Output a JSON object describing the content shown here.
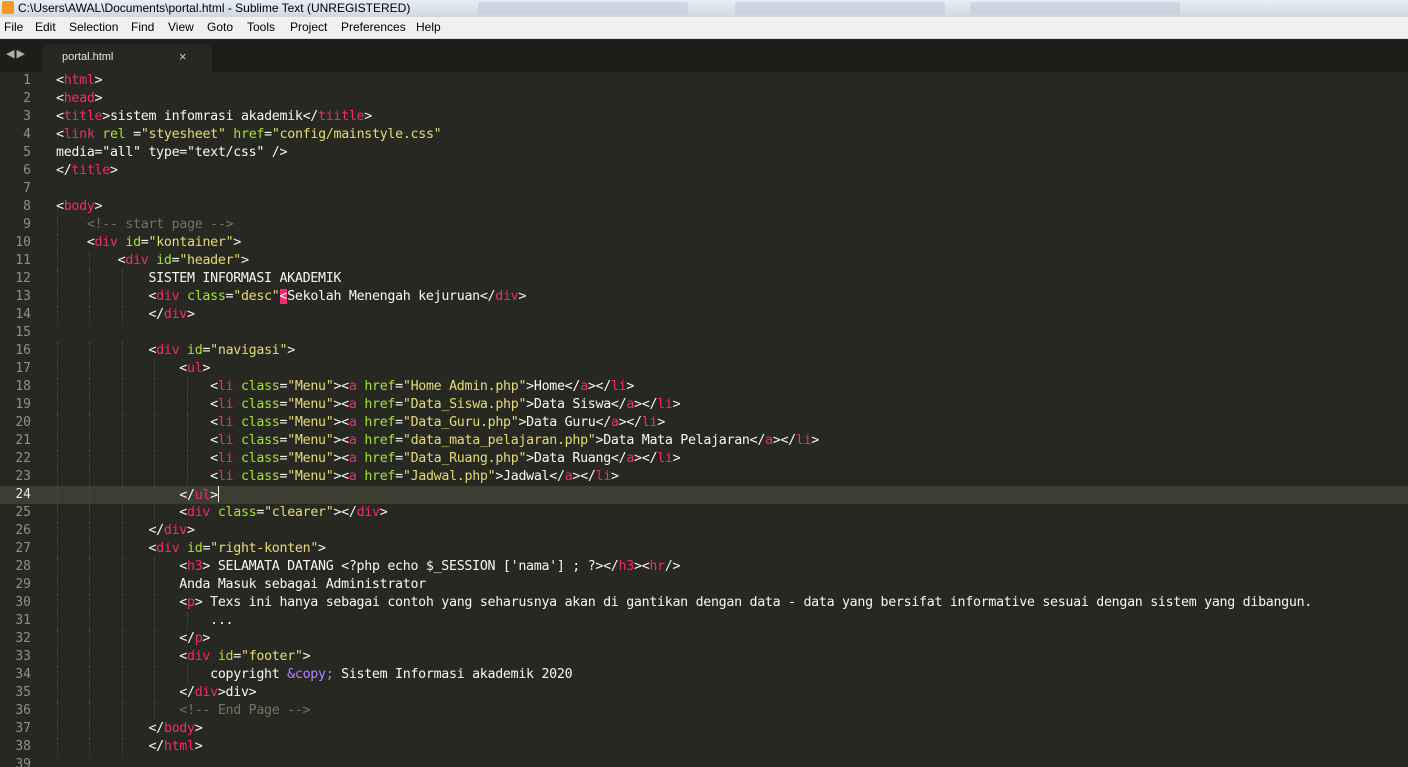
{
  "window": {
    "title": "C:\\Users\\AWAL\\Documents\\portal.html - Sublime Text (UNREGISTERED)"
  },
  "menu": [
    "File",
    "Edit",
    "Selection",
    "Find",
    "View",
    "Goto",
    "Tools",
    "Project",
    "Preferences",
    "Help"
  ],
  "tab": {
    "label": "portal.html",
    "close": "×"
  },
  "nav": {
    "back": "◀",
    "forward": "▶"
  },
  "editor": {
    "current_line": 24,
    "colors": {
      "background": "#272822",
      "tag": "#f92672",
      "attribute": "#a6e22e",
      "string": "#e6db74",
      "comment": "#75715e",
      "entity": "#ae81ff",
      "text": "#f8f8f2"
    },
    "lines": [
      "<html>",
      "<head>",
      "<title>sistem infomrasi akademik</tiitle>",
      "<link rel =\"styesheet\" href=\"config/mainstyle.css\"",
      "media=\"all\" type=\"text/css\" />",
      "</title>",
      "",
      "<body>",
      "    <!-- start page -->",
      "    <div id=\"kontainer\">",
      "        <div id=\"header\">",
      "            SISTEM INFORMASI AKADEMIK",
      "            <div class=\"desc\"<Sekolah Menengah kejuruan</div>",
      "            </div>",
      "",
      "            <div id=\"navigasi\">",
      "                <ul>",
      "                    <li class=\"Menu\"><a href=\"Home Admin.php\">Home</a></li>",
      "                    <li class=\"Menu\"><a href=\"Data_Siswa.php\">Data Siswa</a></li>",
      "                    <li class=\"Menu\"><a href=\"Data_Guru.php\">Data Guru</a></li>",
      "                    <li class=\"Menu\"><a href=\"data_mata_pelajaran.php\">Data Mata Pelajaran</a></li>",
      "                    <li class=\"Menu\"><a href=\"Data_Ruang.php\">Data Ruang</a></li>",
      "                    <li class=\"Menu\"><a href=\"Jadwal.php\">Jadwal</a></li>",
      "                </ul>",
      "                <div class=\"clearer\"></div>",
      "            </div>",
      "            <div id=\"right-konten\">",
      "                <h3> SELAMATA DATANG <?php echo $_SESSION ['nama'] ; ?></h3><hr/>",
      "                Anda Masuk sebagai Administrator",
      "                <p> Texs ini hanya sebagai contoh yang seharusnya akan di gantikan dengan data - data yang bersifat informative sesuai dengan sistem yang dibangun.",
      "                    ...",
      "                </p>",
      "                <div id=\"footer\">",
      "                    copyright &copy; Sistem Informasi akademik 2020",
      "                </div>div>",
      "                <!-- End Page -->",
      "            </body>",
      "            </html>",
      ""
    ]
  }
}
